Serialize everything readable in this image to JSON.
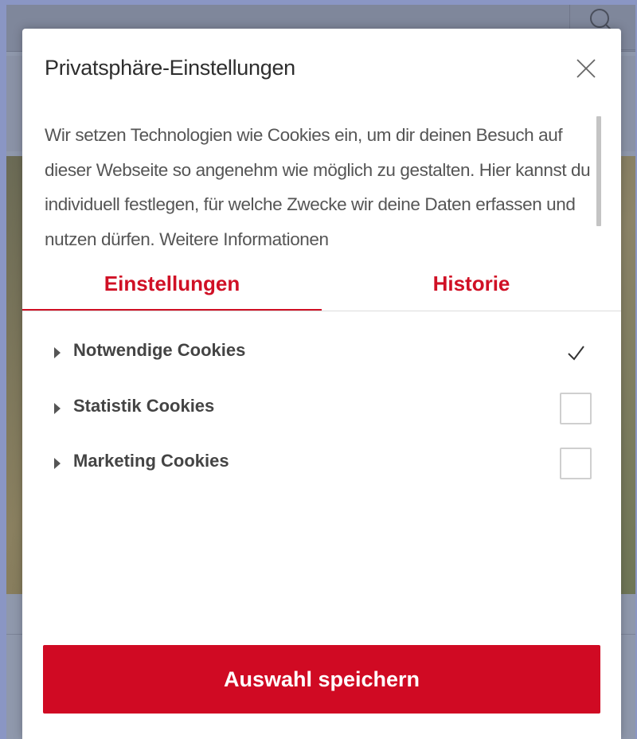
{
  "modal": {
    "title": "Privatsphäre-Einstellungen",
    "intro": "Wir setzen Technologien wie Cookies ein, um dir deinen Besuch auf dieser Webseite so angenehm wie möglich zu gestalten. Hier kannst du individuell festlegen, für welche Zwecke wir deine Daten erfassen und nutzen dürfen. Weitere Informationen",
    "close_icon": "close-icon"
  },
  "tabs": [
    {
      "label": "Einstellungen",
      "active": true
    },
    {
      "label": "Historie",
      "active": false
    }
  ],
  "cookies": [
    {
      "label": "Notwendige Cookies",
      "checked": true,
      "locked": true
    },
    {
      "label": "Statistik Cookies",
      "checked": false
    },
    {
      "label": "Marketing Cookies",
      "checked": false
    }
  ],
  "save_label": "Auswahl speichern",
  "colors": {
    "accent": "#d00a23",
    "overlay": "#8a96c4",
    "text": "#444444"
  }
}
